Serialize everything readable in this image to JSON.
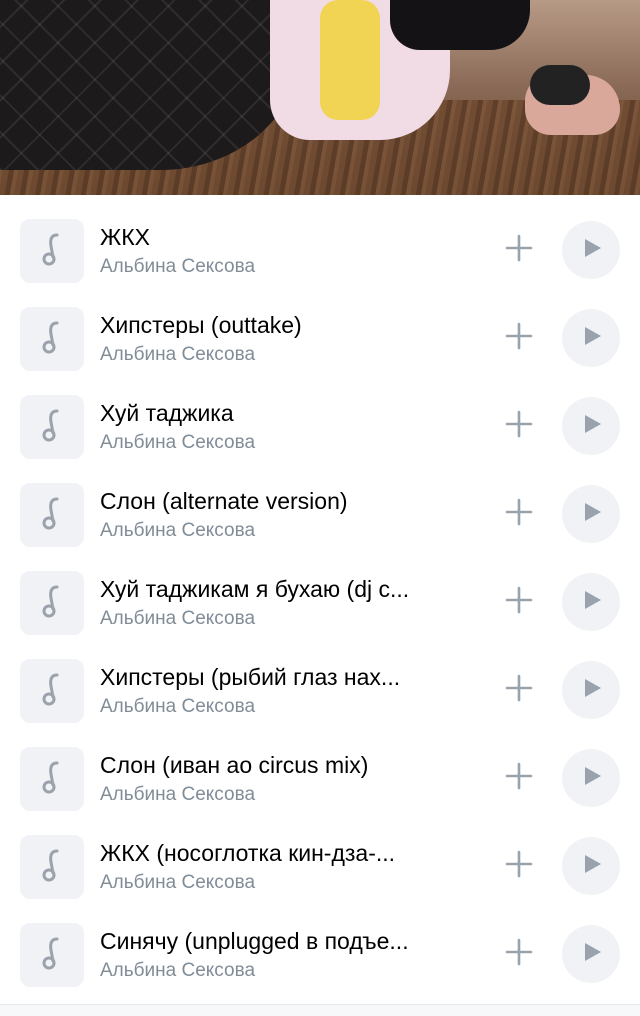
{
  "header": {
    "image": "photo-banner"
  },
  "tracks": [
    {
      "title": "ЖКХ",
      "artist": "Альбина Сексова"
    },
    {
      "title": "Хипстеры (outtake)",
      "artist": "Альбина Сексова"
    },
    {
      "title": "Хуй таджика",
      "artist": "Альбина Сексова"
    },
    {
      "title": "Слон (alternate version)",
      "artist": "Альбина Сексова"
    },
    {
      "title": "Хуй таджикам я бухаю (dj c...",
      "artist": "Альбина Сексова"
    },
    {
      "title": "Хипстеры (рыбий глаз нах...",
      "artist": "Альбина Сексова"
    },
    {
      "title": "Слон (иван ао circus mix)",
      "artist": "Альбина Сексова"
    },
    {
      "title": "ЖКХ (носоглотка кин-дза-...",
      "artist": "Альбина Сексова"
    },
    {
      "title": "Синячу (unplugged в подъе...",
      "artist": "Альбина Сексова"
    }
  ],
  "icons": {
    "cover": "music-note-icon",
    "add": "plus-icon",
    "play": "play-icon"
  },
  "colors": {
    "accent_gray": "#99a2ad",
    "secondary_text": "#818c99",
    "cover_bg": "#f0f2f5"
  }
}
